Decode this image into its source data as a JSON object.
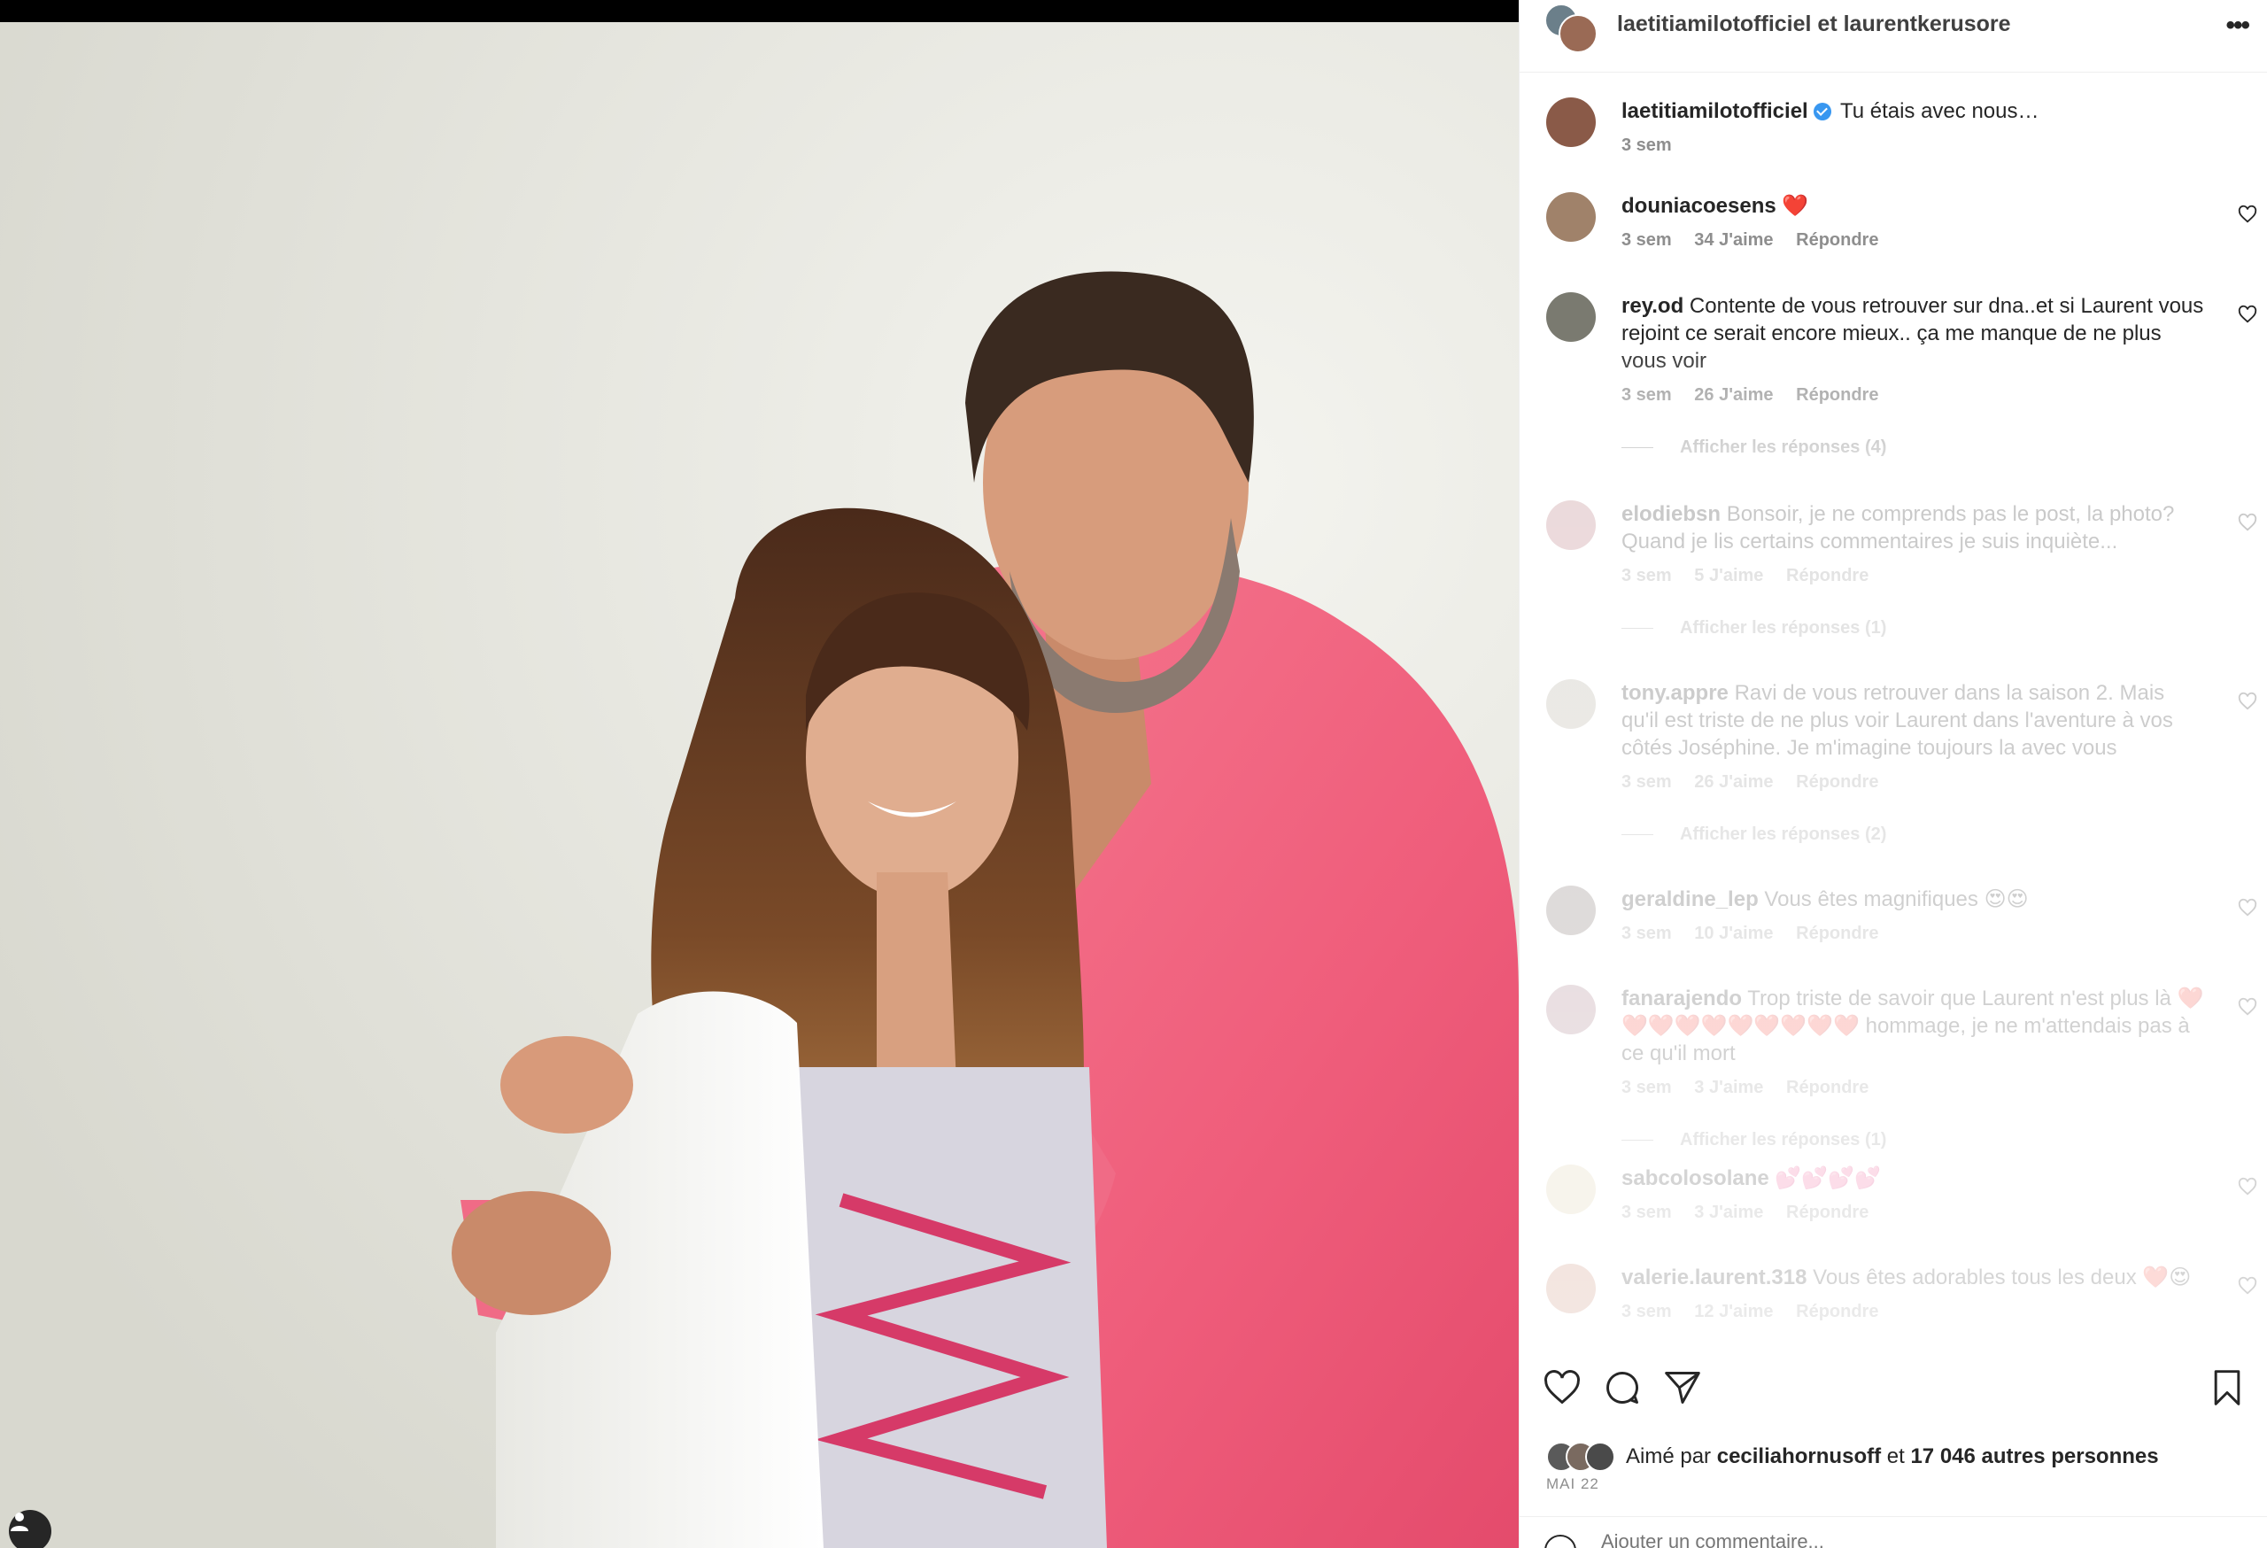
{
  "header": {
    "title": "laetitiamilotofficiel et laurentkerusore",
    "more_label": "•••"
  },
  "caption": {
    "username": "laetitiamilotofficiel",
    "text": "Tu étais avec nous…",
    "time": "3 sem"
  },
  "comments": [
    {
      "username": "douniacoesens",
      "text": "❤️",
      "time": "3 sem",
      "likes": "34 J'aime",
      "reply": "Répondre"
    },
    {
      "username": "rey.od",
      "text": "Contente de vous retrouver sur dna..et si Laurent vous rejoint ce serait encore mieux.. ça me manque de ne plus vous voir",
      "time": "3 sem",
      "likes": "26 J'aime",
      "reply": "Répondre",
      "view_replies": "Afficher les réponses (4)"
    },
    {
      "username": "elodiebsn",
      "text": "Bonsoir, je ne comprends pas le post, la photo? Quand je lis certains commentaires je suis inquiète...",
      "time": "3 sem",
      "likes": "5 J'aime",
      "reply": "Répondre",
      "view_replies": "Afficher les réponses (1)"
    },
    {
      "username": "tony.appre",
      "text": "Ravi de vous retrouver dans la saison 2. Mais qu'il est triste de ne plus voir Laurent dans l'aventure à vos côtés Joséphine. Je m'imagine toujours la avec vous",
      "time": "3 sem",
      "likes": "26 J'aime",
      "reply": "Répondre",
      "view_replies": "Afficher les réponses (2)"
    },
    {
      "username": "geraldine_lep",
      "text": "Vous êtes magnifiques 😍😍",
      "time": "3 sem",
      "likes": "10 J'aime",
      "reply": "Répondre"
    },
    {
      "username": "fanarajendo",
      "text": "Trop triste de savoir que Laurent n'est plus là ❤️❤️❤️❤️❤️❤️❤️❤️❤️❤️ hommage, je ne m'attendais pas à ce qu'il mort",
      "time": "3 sem",
      "likes": "3 J'aime",
      "reply": "Répondre",
      "view_replies": "Afficher les réponses (1)"
    },
    {
      "username": "sabcolosolane",
      "text": "💕💕💕💕",
      "time": "3 sem",
      "likes": "3 J'aime",
      "reply": "Répondre"
    },
    {
      "username": "valerie.laurent.318",
      "text": "Vous êtes adorables tous les deux ❤️😍",
      "time": "3 sem",
      "likes": "12 J'aime",
      "reply": "Répondre"
    }
  ],
  "likes": {
    "prefix": "Aimé par",
    "user": "ceciliahornusoff",
    "middle": "et",
    "others": "17 046 autres personnes"
  },
  "post_date": "MAI 22",
  "add_comment": {
    "placeholder": "Ajouter un commentaire..."
  },
  "colors": {
    "shirt_pink": "#f0617f",
    "verified_blue": "#3897f0",
    "meta_gray": "#8e8e8e",
    "heart_red": "#ed4956"
  },
  "icons": [
    "heart-icon",
    "comment-icon",
    "share-icon",
    "bookmark-icon",
    "more-icon",
    "user-tag-icon",
    "verified-icon"
  ]
}
